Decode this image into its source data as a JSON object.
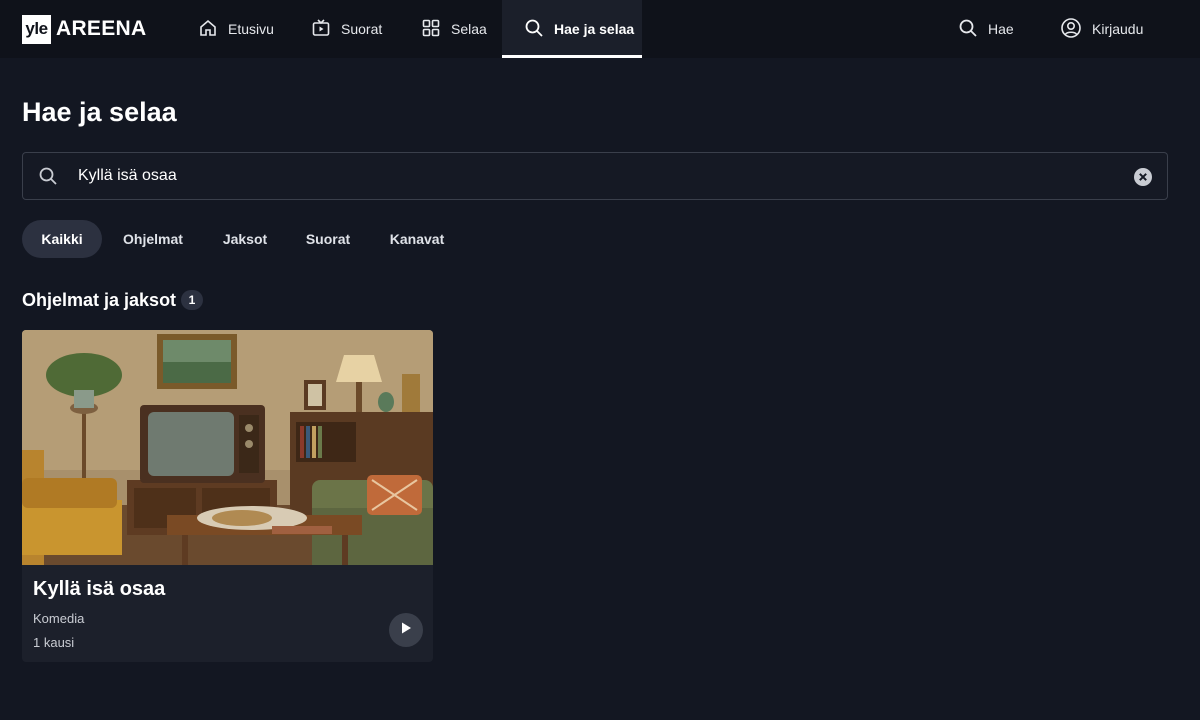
{
  "logo": {
    "badge": "yle",
    "text": "AREENA"
  },
  "nav": {
    "items": [
      {
        "label": "Etusivu",
        "icon": "home-icon"
      },
      {
        "label": "Suorat",
        "icon": "live-tv-icon"
      },
      {
        "label": "Selaa",
        "icon": "grid-icon"
      },
      {
        "label": "Hae ja selaa",
        "icon": "search-icon",
        "active": true
      }
    ],
    "right": [
      {
        "label": "Hae",
        "icon": "search-icon"
      },
      {
        "label": "Kirjaudu",
        "icon": "user-icon"
      }
    ]
  },
  "page": {
    "title": "Hae ja selaa"
  },
  "search": {
    "value": "Kyllä isä osaa"
  },
  "filters": [
    {
      "label": "Kaikki",
      "active": true
    },
    {
      "label": "Ohjelmat"
    },
    {
      "label": "Jaksot"
    },
    {
      "label": "Suorat"
    },
    {
      "label": "Kanavat"
    }
  ],
  "results": {
    "section_title": "Ohjelmat ja jaksot",
    "count": "1",
    "cards": [
      {
        "title": "Kyllä isä osaa",
        "genre": "Komedia",
        "seasons": "1 kausi"
      }
    ]
  },
  "colors": {
    "background": "#131722",
    "topbar": "#0f121a",
    "card": "#1c202b",
    "chip_active": "#2c3140"
  }
}
